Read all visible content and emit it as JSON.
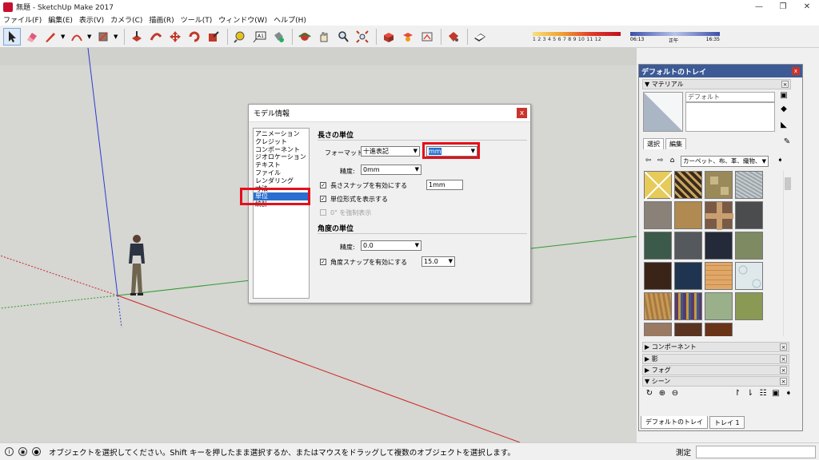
{
  "window": {
    "title": "無題 - SketchUp Make 2017",
    "controls": {
      "minimize": "—",
      "maximize": "❐",
      "close": "✕"
    }
  },
  "menu": [
    "ファイル(F)",
    "編集(E)",
    "表示(V)",
    "カメラ(C)",
    "描画(R)",
    "ツール(T)",
    "ウィンドウ(W)",
    "ヘルプ(H)"
  ],
  "toolbar": {
    "shadow_scale": "1 2 3 4 5 6 7 8 9 10 11 12",
    "time_start": "06:13",
    "time_mid": "正午",
    "time_end": "16:35",
    "colors": {
      "shadow_low": "#f7e07a",
      "shadow_high": "#c01020",
      "time": "#3b4fa8"
    }
  },
  "dialog": {
    "title": "モデル情報",
    "close": "x",
    "categories": [
      "アニメーション",
      "クレジット",
      "コンポーネント",
      "ジオロケーション",
      "テキスト",
      "ファイル",
      "レンダリング",
      "寸法",
      "単位",
      "統計"
    ],
    "selected_category": "単位",
    "length_section": "長さの単位",
    "format_label": "フォーマット:",
    "format_value": "十進表記",
    "unit_value": "mm",
    "precision_label": "精度:",
    "precision_value": "0mm",
    "length_snap_label": "長さスナップを有効にする",
    "length_snap_checked": "✓",
    "length_snap_value": "1mm",
    "unit_format_label": "単位形式を表示する",
    "unit_format_checked": "✓",
    "force_zero_label": "0\" を強制表示",
    "angle_section": "角度の単位",
    "angle_precision_label": "精度:",
    "angle_precision_value": "0.0",
    "angle_snap_label": "角度スナップを有効にする",
    "angle_snap_checked": "✓",
    "angle_snap_value": "15.0",
    "highlight_color": "#e3101a"
  },
  "tray": {
    "title": "デフォルトのトレイ",
    "close": "x",
    "materials_panel": "マテリアル",
    "material_name": "デフォルト",
    "tab_select": "選択",
    "tab_edit": "編集",
    "library": "カーペット、布、革、織物、",
    "panels": [
      "コンポーネント",
      "影",
      "フォグ",
      "シーン"
    ],
    "tabs": [
      "デフォルトのトレイ",
      "トレイ 1"
    ]
  },
  "status": {
    "text": "オブジェクトを選択してください。Shift キーを押したまま選択するか、またはマウスをドラッグして複数のオブジェクトを選択します。",
    "measure_label": "測定",
    "icons": [
      "info-icon",
      "geo-icon",
      "user-icon"
    ]
  }
}
